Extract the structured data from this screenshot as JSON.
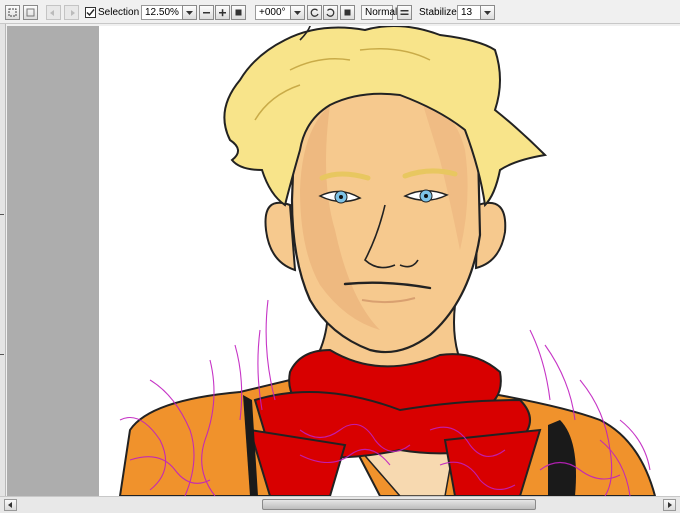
{
  "toolbar": {
    "selection_label": "Selection",
    "selection_checked": true,
    "zoom_value": "12.50%",
    "rotation_value": "+000°",
    "blend_mode": "Normal",
    "stabilizer_label": "Stabilizer",
    "stabilizer_value": "13"
  },
  "icons": [
    "select-all-icon",
    "deselect-icon",
    "undo-icon",
    "redo-icon",
    "zoom-out-icon",
    "zoom-in-icon",
    "zoom-reset-icon",
    "rotate-left-icon",
    "rotate-right-icon",
    "rotate-reset-icon",
    "flip-icon",
    "dropdown-arrow-icon"
  ],
  "colors": {
    "hair": "#f8e48a",
    "skin": "#f6c98e",
    "skin_shadow": "#eab07a",
    "eyes": "#7ec3e6",
    "scarf": "#d80000",
    "jacket": "#f0922c",
    "sketch_lines": "#c020c0",
    "margin_gray": "#adadad"
  }
}
